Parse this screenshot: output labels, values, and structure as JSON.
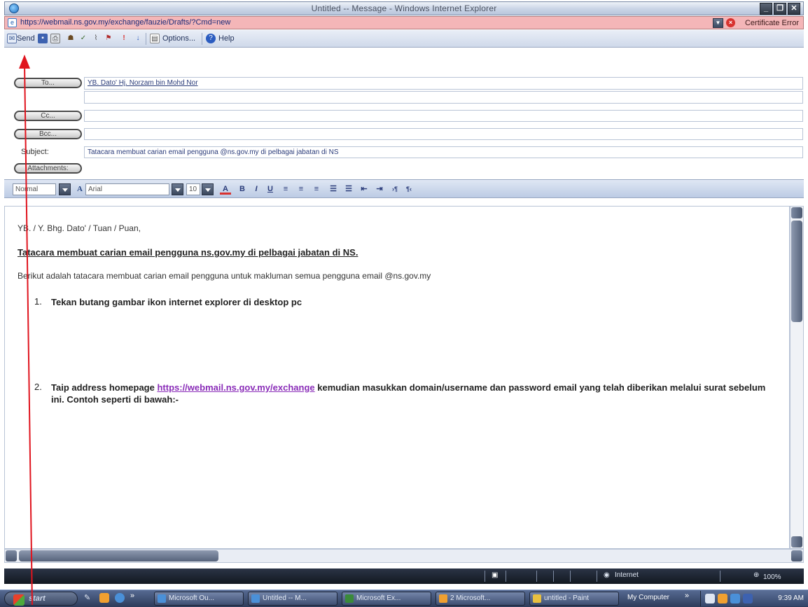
{
  "window": {
    "title": "Untitled -- Message - Windows Internet Explorer",
    "url": "https://webmail.ns.gov.my/exchange/fauzie/Drafts/?Cmd=new",
    "cert_error": "Certificate Error"
  },
  "toolbar": {
    "send": "Send",
    "options": "Options...",
    "help": "Help"
  },
  "header": {
    "to_button": "To...",
    "to_value": "YB. Dato' Hj. Norzam bin Mohd Nor",
    "cc_button": "Cc...",
    "bcc_button": "Bcc...",
    "subject_label": "Subject:",
    "subject_value": "Tatacara membuat carian email pengguna @ns.gov.my di pelbagai jabatan di NS",
    "attachments_button": "Attachments:"
  },
  "format": {
    "style": "Normal",
    "font": "Arial",
    "size": "10"
  },
  "body": {
    "greeting": "YB. / Y. Bhg. Dato' / Tuan / Puan,",
    "subject_line": "Tatacara membuat carian email pengguna ns.gov.my di pelbagai jabatan di NS.",
    "intro": "Berikut adalah tatacara membuat carian email pengguna untuk makluman semua pengguna email @ns.gov.my",
    "step1_num": "1.",
    "step1": "Tekan butang gambar ikon internet explorer di desktop pc",
    "step2_num": "2.",
    "step2_pre": "Taip address homepage ",
    "step2_link": "https://webmail.ns.gov.my/exchange",
    "step2_post": " kemudian masukkan domain/username dan password email yang telah diberikan melalui surat sebelum ini. Contoh seperti di bawah:-"
  },
  "statusbar": {
    "zone": "Internet",
    "zoom": "100%"
  },
  "taskbar": {
    "start": "start",
    "tasks": [
      "Microsoft Ou...",
      "Untitled -- M...",
      "Microsoft Ex...",
      "2 Microsoft...",
      "untitled - Paint"
    ],
    "my_computer": "My Computer",
    "clock": "9:39 AM"
  },
  "colors": {
    "address_bar": "#f4b6b8",
    "annotation_arrow": "#e0141e",
    "link": "#8a2db8"
  }
}
